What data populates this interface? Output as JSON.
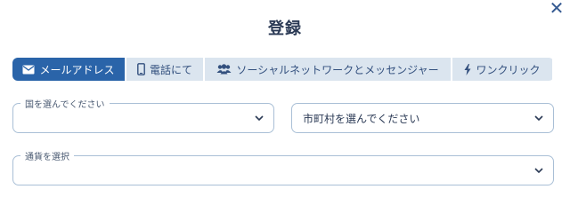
{
  "dialog": {
    "title": "登録",
    "close_label": "✕"
  },
  "tabs": [
    {
      "label": "メールアドレス",
      "icon": "envelope-icon",
      "active": true
    },
    {
      "label": "電話にて",
      "icon": "phone-icon",
      "active": false
    },
    {
      "label": "ソーシャルネットワークとメッセンジャー",
      "icon": "users-icon",
      "active": false
    },
    {
      "label": "ワンクリック",
      "icon": "lightning-icon",
      "active": false
    }
  ],
  "form": {
    "country": {
      "legend": "国を選んでください",
      "value": ""
    },
    "city": {
      "legend": "",
      "value": "市町村を選んでください"
    },
    "currency": {
      "legend": "通貨を選択",
      "value": ""
    }
  },
  "colors": {
    "accent": "#2a64a9",
    "tab_bg": "#dbe5ef",
    "border": "#a9bfd6",
    "text": "#2b3a55"
  }
}
